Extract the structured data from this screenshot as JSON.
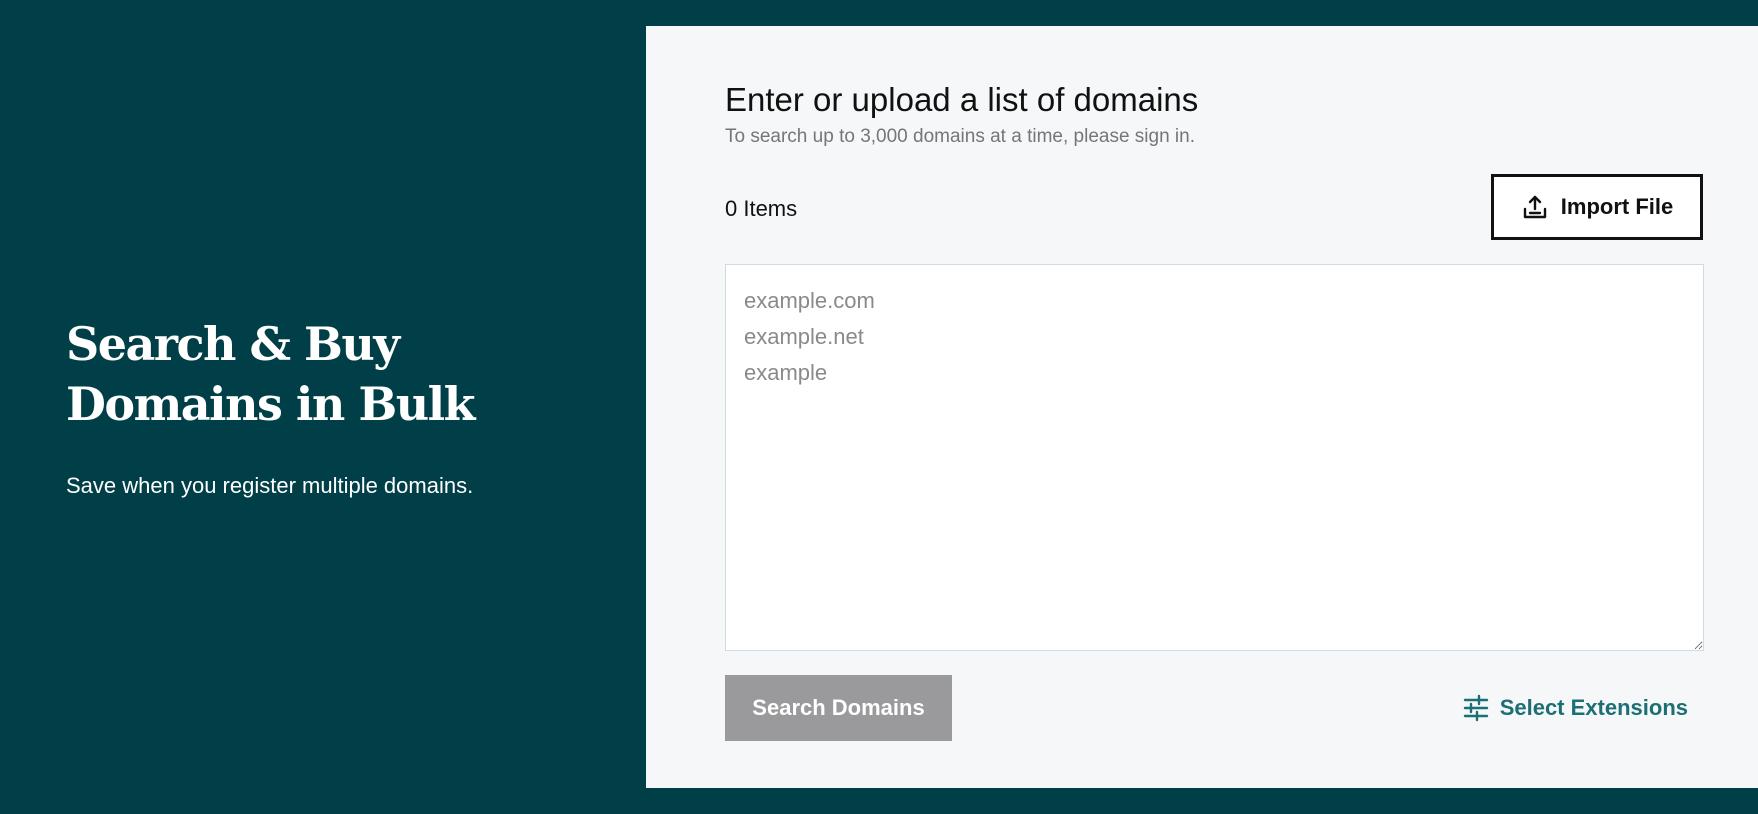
{
  "hero": {
    "title": "Search & Buy Domains in Bulk",
    "subtitle": "Save when you register multiple domains."
  },
  "panel": {
    "title": "Enter or upload a list of domains",
    "subtitle": "To search up to 3,000 domains at a time, please sign in.",
    "item_count": "0 Items",
    "import_button_label": "Import File",
    "import_icon": "upload-icon",
    "domain_input": {
      "value": "",
      "placeholder": "example.com\nexample.net\nexample"
    },
    "search_button_label": "Search Domains",
    "search_button_disabled": true,
    "extensions_button_label": "Select Extensions",
    "extensions_icon": "sliders-icon"
  },
  "colors": {
    "background": "#003f48",
    "panel": "#f5f7f8",
    "accent": "#1b6f75",
    "disabled_button": "#9a9a9c"
  }
}
